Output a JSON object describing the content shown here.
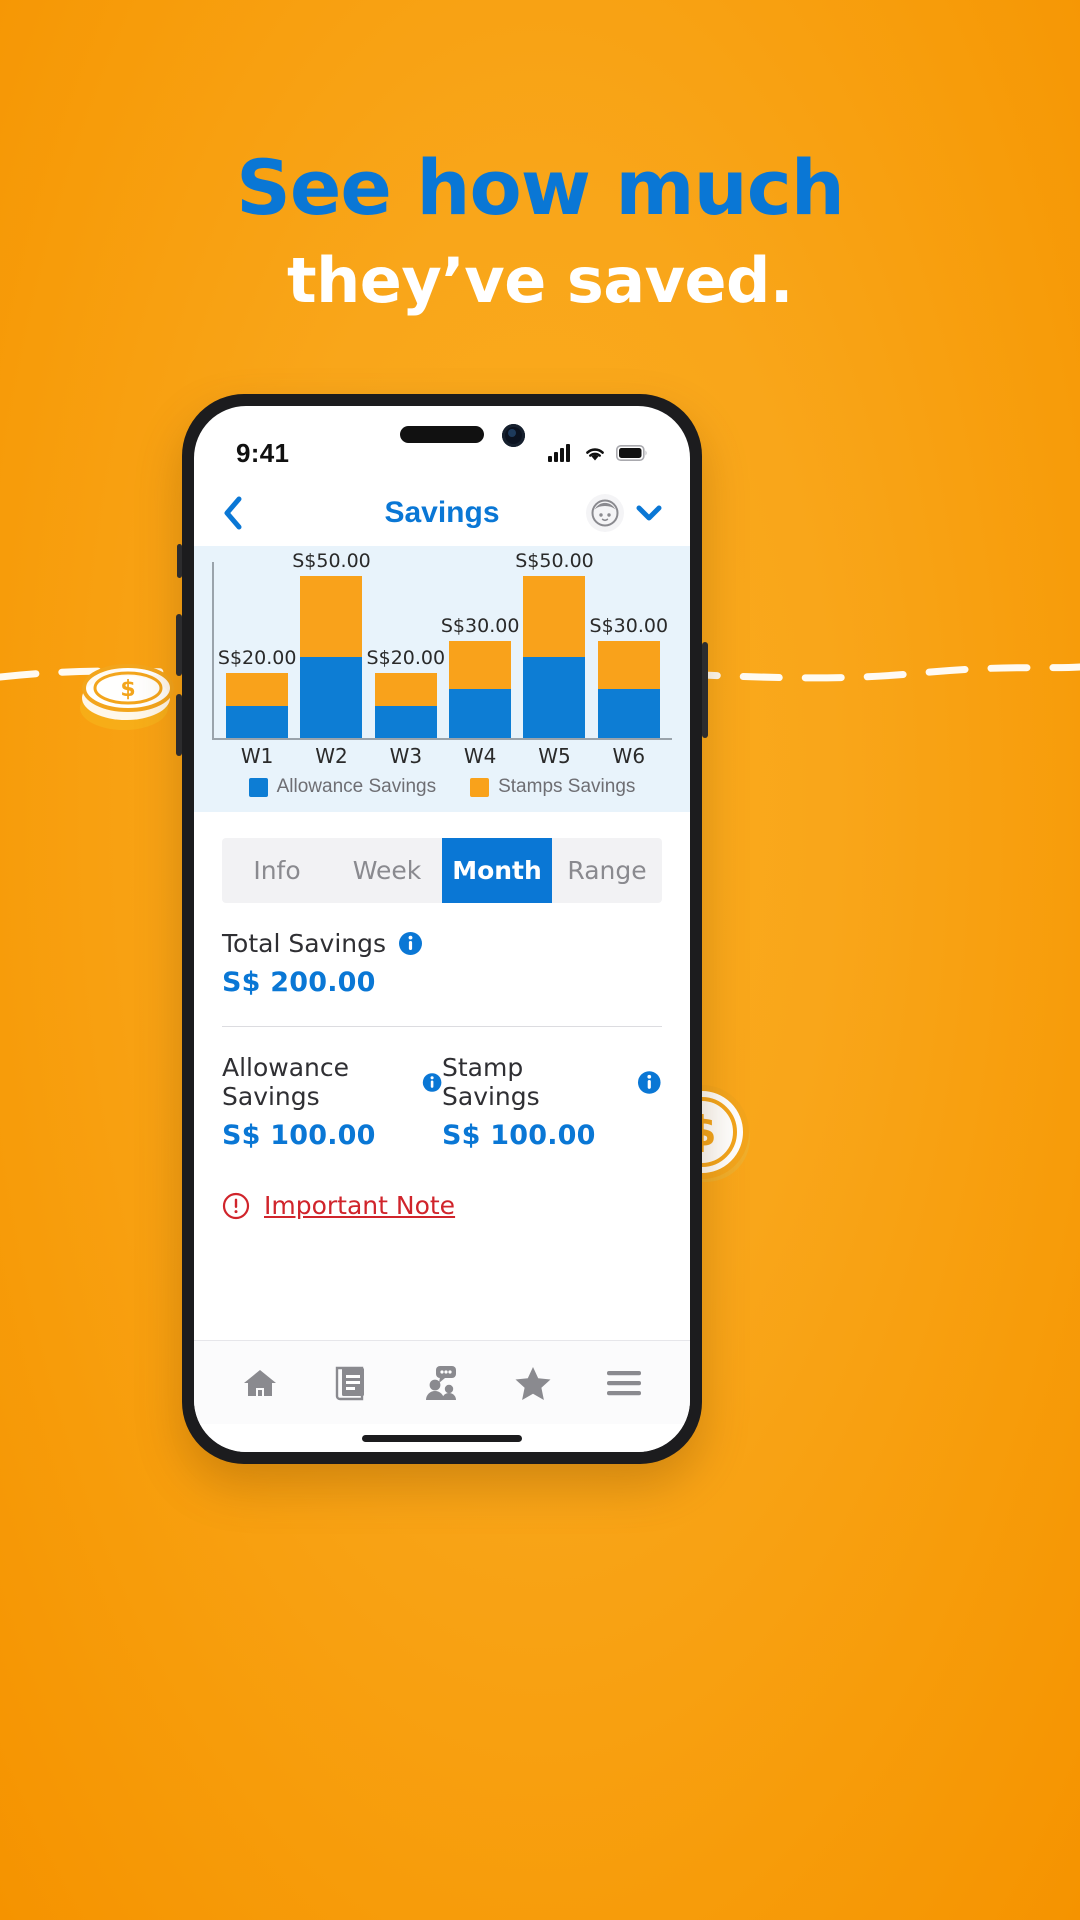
{
  "promo": {
    "headline": "See how much",
    "subhead": "they’ve saved.",
    "headline_color": "#0A77D5",
    "background_color": "#F9A61A"
  },
  "status_bar": {
    "time": "9:41",
    "signal_icon": "cellular-signal-icon",
    "wifi_icon": "wifi-icon",
    "battery_icon": "battery-icon"
  },
  "navbar": {
    "back_icon": "chevron-left-icon",
    "title": "Savings",
    "avatar_icon": "child-avatar-icon",
    "chevron_icon": "chevron-down-icon"
  },
  "chart_data": {
    "type": "bar",
    "title": "",
    "categories": [
      "W1",
      "W2",
      "W3",
      "W4",
      "W5",
      "W6"
    ],
    "stacked": true,
    "series": [
      {
        "name": "Allowance Savings",
        "color": "#0D7DD4",
        "values": [
          10,
          25,
          10,
          15,
          25,
          15
        ]
      },
      {
        "name": "Stamps Savings",
        "color": "#F9A21B",
        "values": [
          10,
          25,
          10,
          15,
          25,
          15
        ]
      }
    ],
    "totals": [
      20,
      50,
      20,
      30,
      50,
      30
    ],
    "data_labels": [
      "S$20.00",
      "S$50.00",
      "S$20.00",
      "S$30.00",
      "S$50.00",
      "S$30.00"
    ],
    "xlabel": "",
    "ylabel": "",
    "ylim": [
      0,
      55
    ],
    "grid": false,
    "legend_position": "bottom",
    "currency_prefix": "S$"
  },
  "segmented": {
    "tabs": [
      {
        "label": "Info",
        "active": false
      },
      {
        "label": "Week",
        "active": false
      },
      {
        "label": "Month",
        "active": true
      },
      {
        "label": "Range",
        "active": false
      }
    ],
    "active_color": "#0A77D5"
  },
  "details": {
    "total": {
      "label": "Total Savings",
      "info_icon": "info-icon",
      "amount": "S$ 200.00"
    },
    "allowance": {
      "label": "Allowance Savings",
      "info_icon": "info-icon",
      "amount": "S$ 100.00"
    },
    "stamp": {
      "label": "Stamp Savings",
      "info_icon": "info-icon",
      "amount": "S$ 100.00"
    },
    "note": {
      "icon": "alert-circle-icon",
      "label": "Important Note",
      "color": "#D0242B"
    }
  },
  "tabbar": {
    "items": [
      {
        "name": "home-icon"
      },
      {
        "name": "news-icon"
      },
      {
        "name": "community-icon"
      },
      {
        "name": "star-icon"
      },
      {
        "name": "menu-icon"
      }
    ]
  }
}
